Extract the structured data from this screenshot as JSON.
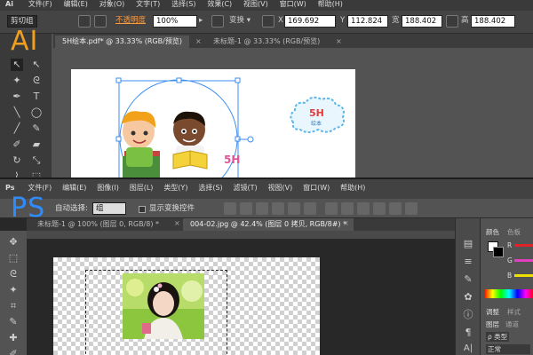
{
  "ai": {
    "logo_small": "Ai",
    "big_label": "AI",
    "menu": [
      "文件(F)",
      "编辑(E)",
      "对象(O)",
      "文字(T)",
      "选择(S)",
      "效果(C)",
      "视图(V)",
      "窗口(W)",
      "帮助(H)"
    ],
    "control": {
      "group_label": "剪切组",
      "opacity_label": "不透明度",
      "opacity_value": "100%",
      "x_value": "169.692",
      "y_value": "112.824",
      "w_value": "188.402",
      "h_value": "188.402"
    },
    "tabs": [
      "5H绘本.pdf* @ 33.33% (RGB/预览)",
      "未标题-1 @ 33.33% (RGB/预览)"
    ],
    "logo_text": "5H",
    "logo_sub": "绘本",
    "pink_text": "5H"
  },
  "ps": {
    "logo_small": "Ps",
    "big_label": "PS",
    "menu": [
      "文件(F)",
      "编辑(E)",
      "图像(I)",
      "图层(L)",
      "类型(Y)",
      "选择(S)",
      "滤镜(T)",
      "视图(V)",
      "窗口(W)",
      "帮助(H)"
    ],
    "options": {
      "auto_select": "自动选择:",
      "group_value": "组",
      "show_transform": "显示变换控件"
    },
    "tabs": [
      "未标题-1 @ 100% (图层 0, RGB/8) *",
      "004-02.jpg @ 42.4% (图层 0 拷贝, RGB/8#) *"
    ],
    "panels": {
      "color_tab": "颜色",
      "swatches_tab": "色板",
      "r_label": "R",
      "g_label": "G",
      "b_label": "B",
      "adjust_tab": "调整",
      "style_tab": "样式",
      "layers_tab": "图层",
      "channels_tab": "通道",
      "path_tab": "路径",
      "kind_value": "类型",
      "blend_value": "正常"
    },
    "colors": {
      "r_slider": "#e0222a",
      "g_slider": "#e040c0",
      "b_slider": "#f0e000"
    }
  },
  "overlay_colors": {
    "ai_label": "#f0a020",
    "ps_label": "#2f8cff"
  }
}
